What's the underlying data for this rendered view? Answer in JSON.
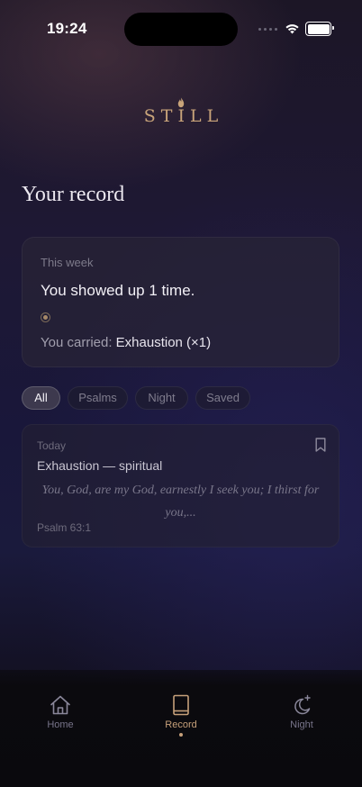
{
  "status_bar": {
    "time": "19:24"
  },
  "brand": {
    "name": "STILL",
    "accent": "#c9a47a"
  },
  "page": {
    "title": "Your record"
  },
  "summary": {
    "period_label": "This week",
    "headline": "You showed up 1 time.",
    "carried_prefix": "You carried: ",
    "carried_value": "Exhaustion (×1)"
  },
  "filters": {
    "selected": "All",
    "items": [
      "All",
      "Psalms",
      "Night",
      "Saved"
    ]
  },
  "entries": [
    {
      "date": "Today",
      "title": "Exhaustion — spiritual",
      "verse": "You, God, are my God, earnestly I seek you; I thirst for you,...",
      "reference": "Psalm 63:1",
      "icon": "bookmark-icon"
    }
  ],
  "tab_bar": {
    "active": "Record",
    "tabs": [
      {
        "label": "Home",
        "icon": "home-icon"
      },
      {
        "label": "Record",
        "icon": "book-icon"
      },
      {
        "label": "Night",
        "icon": "moon-icon"
      }
    ]
  }
}
